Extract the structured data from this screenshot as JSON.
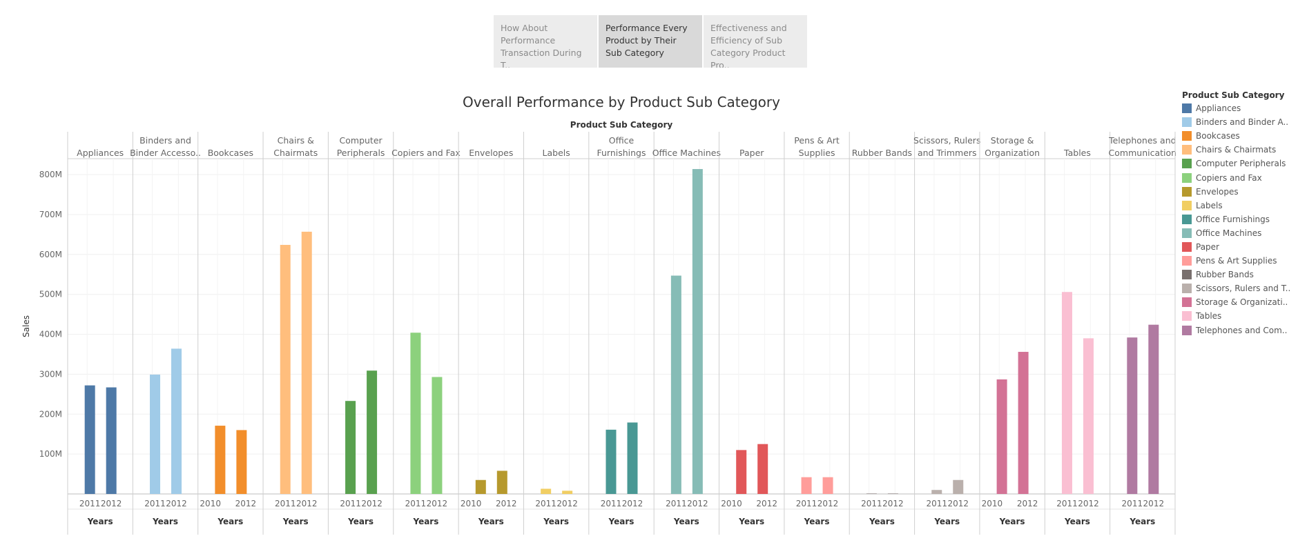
{
  "tabs": [
    {
      "label": "How About Performance Transaction During T..",
      "active": false
    },
    {
      "label": "Performance Every Product by Their Sub Category",
      "active": true
    },
    {
      "label": "Effectiveness and Efficiency of Sub Category Product Pro..",
      "active": false
    }
  ],
  "chart_data": {
    "type": "bar",
    "title": "Overall Performance by Product Sub Category",
    "column_header": "Product Sub Category",
    "ylabel": "Sales",
    "xlabel": "Years",
    "ylim": [
      0,
      840000000
    ],
    "yticks": [
      {
        "value": 100000000,
        "label": "100M"
      },
      {
        "value": 200000000,
        "label": "200M"
      },
      {
        "value": 300000000,
        "label": "300M"
      },
      {
        "value": 400000000,
        "label": "400M"
      },
      {
        "value": 500000000,
        "label": "500M"
      },
      {
        "value": 600000000,
        "label": "600M"
      },
      {
        "value": 700000000,
        "label": "700M"
      },
      {
        "value": 800000000,
        "label": "800M"
      }
    ],
    "grid": true,
    "legend_position": "right",
    "categories": [
      {
        "name": "Appliances",
        "header": [
          "Appliances"
        ],
        "legend": "Appliances",
        "color": "#4e79a7",
        "ticks": [
          "2011",
          "2012"
        ],
        "bars": [
          {
            "year": "2011",
            "value": 272000000
          },
          {
            "year": "2012",
            "value": 267000000
          }
        ]
      },
      {
        "name": "Binders and Binder Accessories",
        "header": [
          "Binders and",
          "Binder Accesso.."
        ],
        "legend": "Binders and Binder A..",
        "color": "#a0cbe8",
        "ticks": [
          "2011",
          "2012"
        ],
        "bars": [
          {
            "year": "2011",
            "value": 299000000
          },
          {
            "year": "2012",
            "value": 364000000
          }
        ]
      },
      {
        "name": "Bookcases",
        "header": [
          "Bookcases"
        ],
        "legend": "Bookcases",
        "color": "#f28e2b",
        "ticks": [
          "2010",
          "2012"
        ],
        "bars": [
          {
            "year": "2011",
            "value": 171000000
          },
          {
            "year": "2012",
            "value": 160000000
          }
        ]
      },
      {
        "name": "Chairs & Chairmats",
        "header": [
          "Chairs &",
          "Chairmats"
        ],
        "legend": "Chairs & Chairmats",
        "color": "#ffbe7d",
        "ticks": [
          "2011",
          "2012"
        ],
        "bars": [
          {
            "year": "2011",
            "value": 624000000
          },
          {
            "year": "2012",
            "value": 657000000
          }
        ]
      },
      {
        "name": "Computer Peripherals",
        "header": [
          "Computer",
          "Peripherals"
        ],
        "legend": "Computer Peripherals",
        "color": "#59a14f",
        "ticks": [
          "2011",
          "2012"
        ],
        "bars": [
          {
            "year": "2011",
            "value": 233000000
          },
          {
            "year": "2012",
            "value": 309000000
          }
        ]
      },
      {
        "name": "Copiers and Fax",
        "header": [
          "Copiers and Fax"
        ],
        "legend": "Copiers and Fax",
        "color": "#8cd17d",
        "ticks": [
          "2011",
          "2012"
        ],
        "bars": [
          {
            "year": "2011",
            "value": 404000000
          },
          {
            "year": "2012",
            "value": 293000000
          }
        ]
      },
      {
        "name": "Envelopes",
        "header": [
          "Envelopes"
        ],
        "legend": "Envelopes",
        "color": "#b6992d",
        "ticks": [
          "2010",
          "2012"
        ],
        "bars": [
          {
            "year": "2011",
            "value": 35000000
          },
          {
            "year": "2012",
            "value": 58000000
          }
        ]
      },
      {
        "name": "Labels",
        "header": [
          "Labels"
        ],
        "legend": "Labels",
        "color": "#f1ce63",
        "ticks": [
          "2011",
          "2012"
        ],
        "bars": [
          {
            "year": "2011",
            "value": 13000000
          },
          {
            "year": "2012",
            "value": 8000000
          }
        ]
      },
      {
        "name": "Office Furnishings",
        "header": [
          "Office",
          "Furnishings"
        ],
        "legend": "Office Furnishings",
        "color": "#499894",
        "ticks": [
          "2011",
          "2012"
        ],
        "bars": [
          {
            "year": "2011",
            "value": 161000000
          },
          {
            "year": "2012",
            "value": 179000000
          }
        ]
      },
      {
        "name": "Office Machines",
        "header": [
          "Office Machines"
        ],
        "legend": "Office Machines",
        "color": "#86bcb6",
        "ticks": [
          "2011",
          "2012"
        ],
        "bars": [
          {
            "year": "2011",
            "value": 547000000
          },
          {
            "year": "2012",
            "value": 814000000
          }
        ]
      },
      {
        "name": "Paper",
        "header": [
          "Paper"
        ],
        "legend": "Paper",
        "color": "#e15759",
        "ticks": [
          "2010",
          "2012"
        ],
        "bars": [
          {
            "year": "2011",
            "value": 110000000
          },
          {
            "year": "2012",
            "value": 125000000
          }
        ]
      },
      {
        "name": "Pens & Art Supplies",
        "header": [
          "Pens & Art",
          "Supplies"
        ],
        "legend": "Pens & Art Supplies",
        "color": "#ff9d9a",
        "ticks": [
          "2011",
          "2012"
        ],
        "bars": [
          {
            "year": "2011",
            "value": 42000000
          },
          {
            "year": "2012",
            "value": 42000000
          }
        ]
      },
      {
        "name": "Rubber Bands",
        "header": [
          "Rubber Bands"
        ],
        "legend": "Rubber Bands",
        "color": "#79706e",
        "ticks": [
          "2011",
          "2012"
        ],
        "bars": [
          {
            "year": "2011",
            "value": 1000000
          },
          {
            "year": "2012",
            "value": 1000000
          }
        ]
      },
      {
        "name": "Scissors, Rulers and Trimmers",
        "header": [
          "Scissors, Rulers",
          "and Trimmers"
        ],
        "legend": "Scissors, Rulers and T..",
        "color": "#bab0ac",
        "ticks": [
          "2011",
          "2012"
        ],
        "bars": [
          {
            "year": "2011",
            "value": 10000000
          },
          {
            "year": "2012",
            "value": 35000000
          }
        ]
      },
      {
        "name": "Storage & Organization",
        "header": [
          "Storage &",
          "Organization"
        ],
        "legend": "Storage & Organizati..",
        "color": "#d37295",
        "ticks": [
          "2010",
          "2012"
        ],
        "bars": [
          {
            "year": "2011",
            "value": 287000000
          },
          {
            "year": "2012",
            "value": 356000000
          }
        ]
      },
      {
        "name": "Tables",
        "header": [
          "Tables"
        ],
        "legend": "Tables",
        "color": "#fabfd2",
        "ticks": [
          "2011",
          "2012"
        ],
        "bars": [
          {
            "year": "2011",
            "value": 506000000
          },
          {
            "year": "2012",
            "value": 390000000
          }
        ]
      },
      {
        "name": "Telephones and Communication",
        "header": [
          "Telephones and",
          "Communication"
        ],
        "legend": "Telephones and Com..",
        "color": "#b07aa1",
        "ticks": [
          "2011",
          "2012"
        ],
        "bars": [
          {
            "year": "2011",
            "value": 392000000
          },
          {
            "year": "2012",
            "value": 424000000
          }
        ]
      }
    ]
  },
  "legend": {
    "title": "Product Sub Category"
  }
}
